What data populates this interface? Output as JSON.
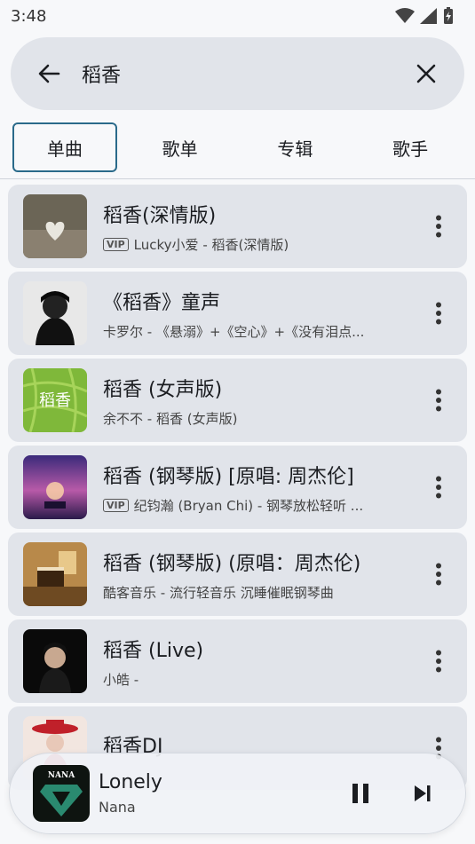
{
  "status_bar": {
    "time": "3:48",
    "icons": [
      "wifi-icon",
      "signal-icon",
      "battery-icon"
    ]
  },
  "search": {
    "query": "稻香",
    "back_icon": "arrow-left-icon",
    "clear_icon": "close-icon"
  },
  "tabs": [
    {
      "label": "单曲",
      "active": true
    },
    {
      "label": "歌单",
      "active": false
    },
    {
      "label": "专辑",
      "active": false
    },
    {
      "label": "歌手",
      "active": false
    }
  ],
  "songs": [
    {
      "title": "稻香(深情版)",
      "vip": "VIP",
      "subtitle": "Lucky小爱 - 稻香(深情版)"
    },
    {
      "title": "《稻香》童声",
      "vip": "",
      "subtitle": "卡罗尔 - 《悬溺》+《空心》+《没有泪点..."
    },
    {
      "title": "稻香 (女声版)",
      "vip": "",
      "subtitle": "余不不 - 稻香 (女声版)"
    },
    {
      "title": "稻香 (钢琴版) [原唱: 周杰伦]",
      "vip": "VIP",
      "subtitle": "纪钧瀚 (Bryan Chi) - 钢琴放松轻听 ..."
    },
    {
      "title": "稻香 (钢琴版) (原唱：周杰伦)",
      "vip": "",
      "subtitle": "酷客音乐 - 流行轻音乐 沉睡催眠钢琴曲"
    },
    {
      "title": "稻香 (Live)",
      "vip": "",
      "subtitle": "小皓 -"
    },
    {
      "title": "稻香DJ",
      "vip": "",
      "subtitle": ""
    }
  ],
  "cover_texts": {
    "song_3": "稻香",
    "player": "NANA"
  },
  "player": {
    "title": "Lonely",
    "artist": "Nana"
  },
  "colors": {
    "background": "#f7f8fa",
    "card": "#e1e4ea",
    "active_tab_border": "#2a6a8a"
  }
}
